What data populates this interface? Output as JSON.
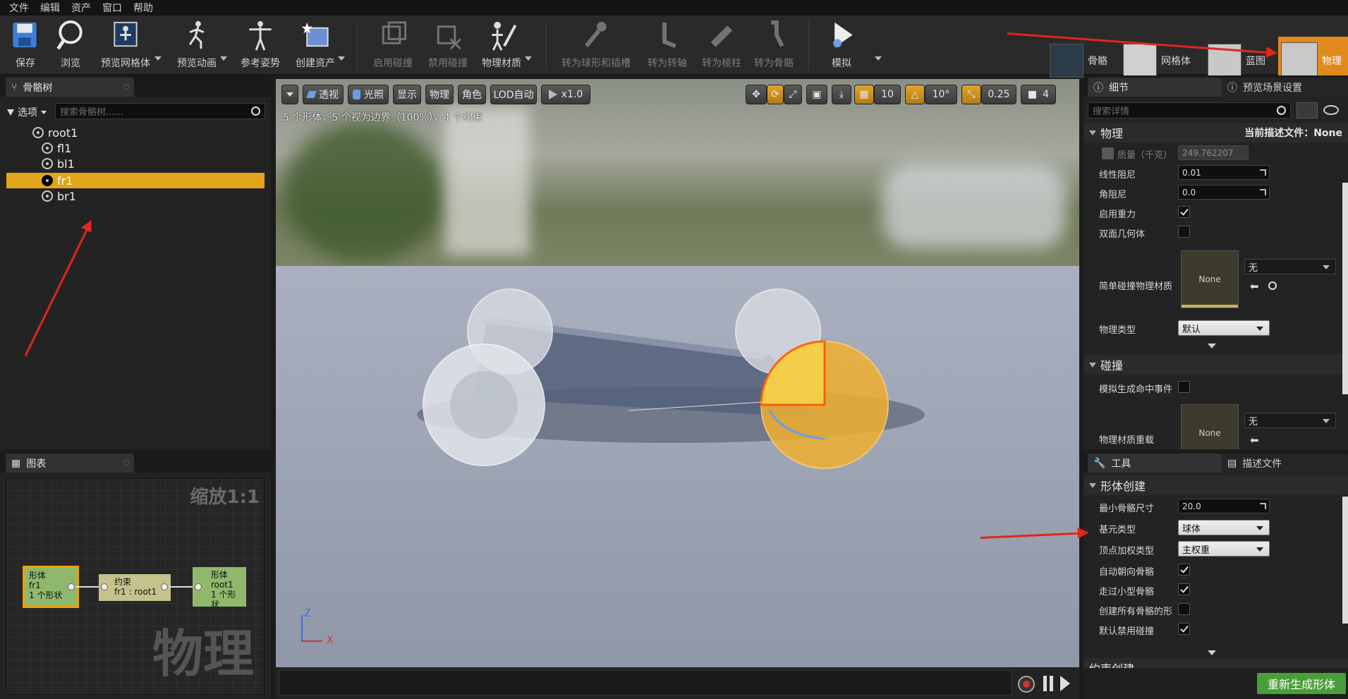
{
  "menu": [
    "文件",
    "编辑",
    "资产",
    "窗口",
    "帮助"
  ],
  "toolbar": {
    "save": "保存",
    "browse": "浏览",
    "preview_mesh": "预览网格体",
    "preview_anim": "预览动画",
    "ref_pose": "参考姿势",
    "create_asset": "创建资产",
    "enable_collision": "启用碰撞",
    "disable_collision": "禁用碰撞",
    "phys_material": "物理材质",
    "to_sphyl": "转为球形和插槽",
    "to_axis": "转为转轴",
    "to_cylinder": "转为棱柱",
    "to_bone": "转为骨骼",
    "simulate": "模拟"
  },
  "modes": [
    {
      "label": "骨骼"
    },
    {
      "label": "网格体"
    },
    {
      "label": "蓝图"
    },
    {
      "label": "物理"
    }
  ],
  "skeleton_panel": {
    "tab": "骨骼树",
    "options": "选项",
    "search_placeholder": "搜索骨骼树......",
    "bones": [
      {
        "name": "root1",
        "depth": 0,
        "selected": false
      },
      {
        "name": "fl1",
        "depth": 1,
        "selected": false
      },
      {
        "name": "bl1",
        "depth": 1,
        "selected": false
      },
      {
        "name": "fr1",
        "depth": 1,
        "selected": true
      },
      {
        "name": "br1",
        "depth": 1,
        "selected": false
      }
    ]
  },
  "graph_panel": {
    "tab": "图表",
    "zoom": "缩放1:1",
    "watermark": "物理",
    "nodes": {
      "shape_fr1": {
        "line1": "形体",
        "line2": "fr1",
        "line3": "1 个形状"
      },
      "constraint": {
        "line1": "约束",
        "line2": "fr1 : root1"
      },
      "shape_root1": {
        "line1": "形体",
        "line2": "root1",
        "line3": "1 个形状"
      }
    }
  },
  "viewport": {
    "buttons": {
      "perspective": "透视",
      "lit": "光照",
      "show": "显示",
      "physics": "物理",
      "character": "角色",
      "lod": "LOD自动",
      "speed": "x1.0",
      "grid": "10",
      "angle": "10°",
      "scale": "0.25",
      "cam_speed": "4"
    },
    "status": "5 个形体，5 个视为边界（100%），4 个约束",
    "axis_z": "Z",
    "axis_x": "X"
  },
  "details": {
    "tab": "细节",
    "tab2": "预览场景设置",
    "search_placeholder": "搜索详情",
    "physics_section": "物理",
    "profile": "当前描述文件：None",
    "props": {
      "mass_label": "质量（千克）",
      "mass": "249.762207",
      "linear_damping_label": "线性阻尼",
      "linear_damping": "0.01",
      "angular_damping_label": "角阻尼",
      "angular_damping": "0.0",
      "gravity_label": "启用重力",
      "double_sided_label": "双面几何体",
      "simple_mat_label": "简单碰撞物理材质",
      "none": "None",
      "wu": "无",
      "phys_type_label": "物理类型",
      "phys_type": "默认"
    },
    "collision_section": "碰撞",
    "collision": {
      "hit_events_label": "模拟生成命中事件",
      "mat_override_label": "物理材质重载",
      "none": "None",
      "wu": "无"
    }
  },
  "tools": {
    "tab": "工具",
    "tab2": "描述文件",
    "section": "形体创建",
    "min_bone_size_label": "最小骨骼尺寸",
    "min_bone_size": "20.0",
    "prim_type_label": "基元类型",
    "prim_type": "球体",
    "vertex_weight_label": "顶点加权类型",
    "vertex_weight": "主权重",
    "auto_orient_label": "自动朝向骨骼",
    "walk_small_label": "走过小型骨骼",
    "create_all_label": "创建所有骨骼的形",
    "disable_collision_label": "默认禁用碰撞",
    "cut_label": "约束创建",
    "regen_button": "重新生成形体"
  },
  "colors": {
    "accent": "#e3a51a",
    "selection": "#e3a51a",
    "regen": "#4a9e3a",
    "arrow": "#e0261f"
  }
}
